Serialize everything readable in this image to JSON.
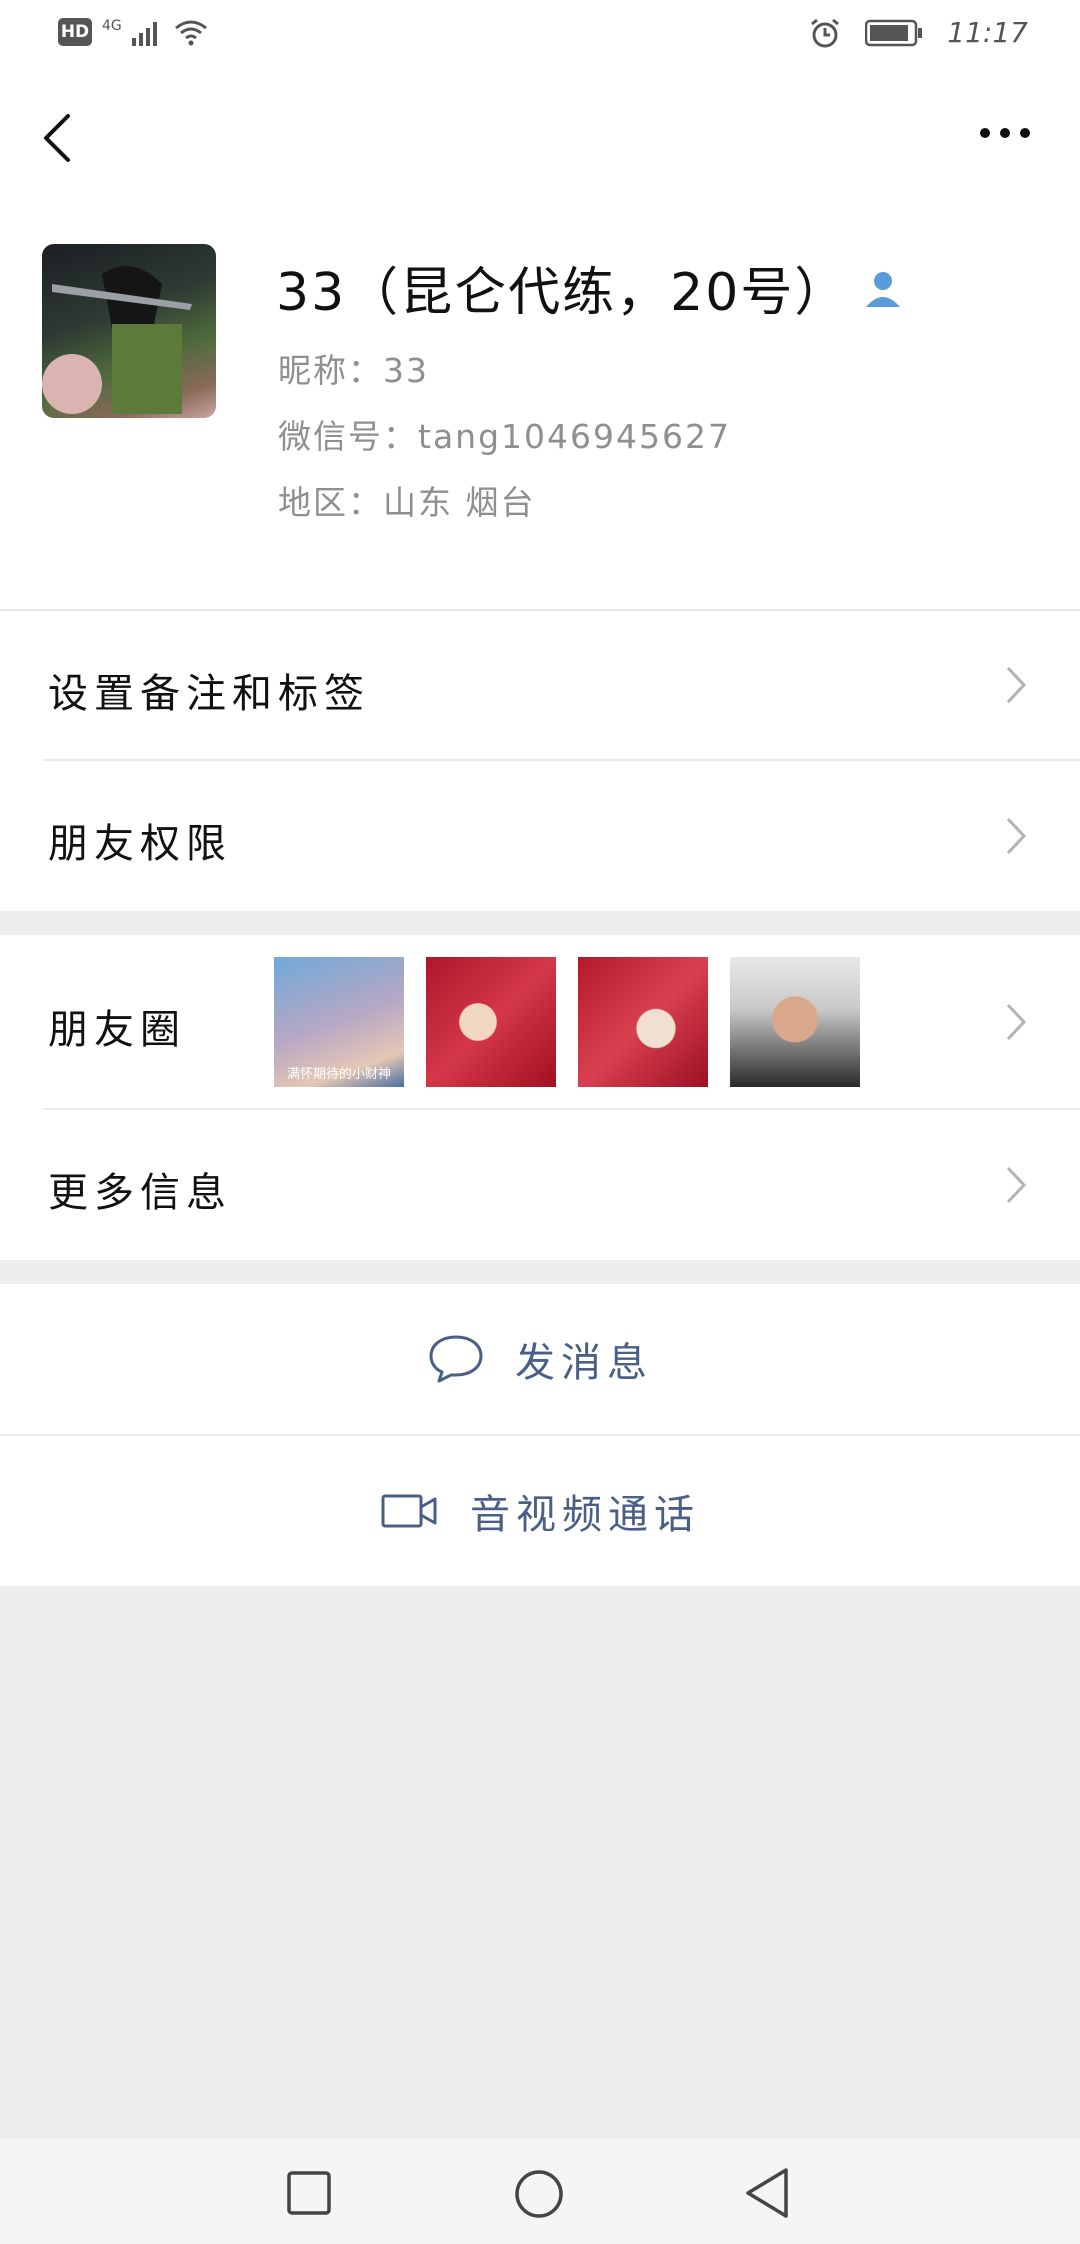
{
  "status_bar": {
    "hd": "HD",
    "network": "4G",
    "time": "11:17"
  },
  "header": {
    "more_icon": "more-icon",
    "back_icon": "back-icon"
  },
  "profile": {
    "name": "33（昆仑代练，20号）",
    "nickname": "昵称：33",
    "wechat_id": "微信号：tang1046945627",
    "region": "地区：山东 烟台"
  },
  "menu": {
    "remark_tags": "设置备注和标签",
    "friend_permissions": "朋友权限",
    "moments": "朋友圈",
    "moments_thumb_caption": "满怀期待的小财神",
    "more_info": "更多信息"
  },
  "actions": {
    "send_message": "发消息",
    "av_call": "音视频通话"
  },
  "colors": {
    "accent": "#4a5f86",
    "badge_blue": "#5b9bd8",
    "background": "#ededed"
  }
}
